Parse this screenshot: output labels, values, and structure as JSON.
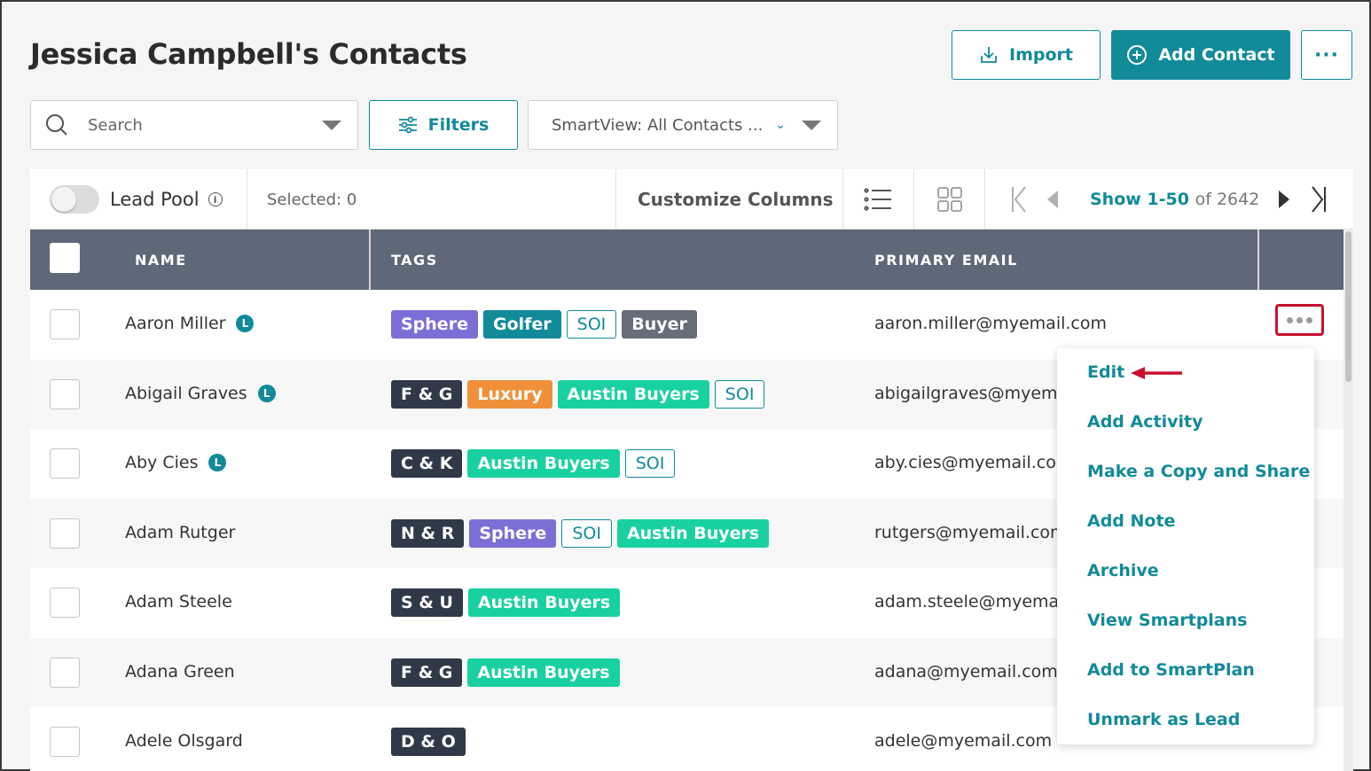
{
  "page": {
    "title": "Jessica Campbell's Contacts"
  },
  "header": {
    "import_label": "Import",
    "add_contact_label": "Add Contact",
    "more_label": "···"
  },
  "search": {
    "placeholder": "Search"
  },
  "filters": {
    "label": "Filters"
  },
  "smartview": {
    "label": "SmartView: All Contacts ..."
  },
  "toolbar": {
    "lead_pool_label": "Lead Pool",
    "selected_label": "Selected: 0",
    "customize_label": "Customize Columns",
    "page_range": "Show 1-50",
    "page_of": "of 2642"
  },
  "table": {
    "headers": {
      "name": "NAME",
      "tags": "TAGS",
      "email": "PRIMARY EMAIL"
    },
    "rows": [
      {
        "name": "Aaron Miller",
        "lead": true,
        "email": "aaron.miller@myemail.com",
        "tags": [
          {
            "text": "Sphere",
            "style": "purple"
          },
          {
            "text": "Golfer",
            "style": "teal"
          },
          {
            "text": "SOI",
            "style": "outline"
          },
          {
            "text": "Buyer",
            "style": "gray"
          }
        ]
      },
      {
        "name": "Abigail Graves",
        "lead": true,
        "email": "abigailgraves@myemail.com",
        "tags": [
          {
            "text": "F & G",
            "style": "dark"
          },
          {
            "text": "Luxury",
            "style": "orange"
          },
          {
            "text": "Austin Buyers",
            "style": "green"
          },
          {
            "text": "SOI",
            "style": "outline"
          }
        ]
      },
      {
        "name": "Aby Cies",
        "lead": true,
        "email": "aby.cies@myemail.com",
        "tags": [
          {
            "text": "C & K",
            "style": "dark"
          },
          {
            "text": "Austin Buyers",
            "style": "green"
          },
          {
            "text": "SOI",
            "style": "outline"
          }
        ]
      },
      {
        "name": "Adam Rutger",
        "lead": false,
        "email": "rutgers@myemail.com",
        "tags": [
          {
            "text": "N & R",
            "style": "dark"
          },
          {
            "text": "Sphere",
            "style": "purple"
          },
          {
            "text": "SOI",
            "style": "outline"
          },
          {
            "text": "Austin Buyers",
            "style": "green"
          }
        ]
      },
      {
        "name": "Adam Steele",
        "lead": false,
        "email": "adam.steele@myemail.com",
        "tags": [
          {
            "text": "S & U",
            "style": "dark"
          },
          {
            "text": "Austin Buyers",
            "style": "green"
          }
        ]
      },
      {
        "name": "Adana Green",
        "lead": false,
        "email": "adana@myemail.com",
        "tags": [
          {
            "text": "F & G",
            "style": "dark"
          },
          {
            "text": "Austin Buyers",
            "style": "green"
          }
        ]
      },
      {
        "name": "Adele Olsgard",
        "lead": false,
        "email": "adele@myemail.com",
        "tags": [
          {
            "text": "D & O",
            "style": "dark"
          }
        ]
      }
    ]
  },
  "lead_badge": "L",
  "menu": {
    "items": [
      "Edit",
      "Add Activity",
      "Make a Copy and Share",
      "Add Note",
      "Archive",
      "View Smartplans",
      "Add to SmartPlan",
      "Unmark as Lead"
    ]
  },
  "colors": {
    "accent": "#118a9a",
    "purple": "#7b6fd6",
    "teal": "#118a9a",
    "gray": "#666c78",
    "dark": "#2f3947",
    "orange": "#f0913a",
    "green": "#19d1a0",
    "annotation": "#c8102e"
  }
}
